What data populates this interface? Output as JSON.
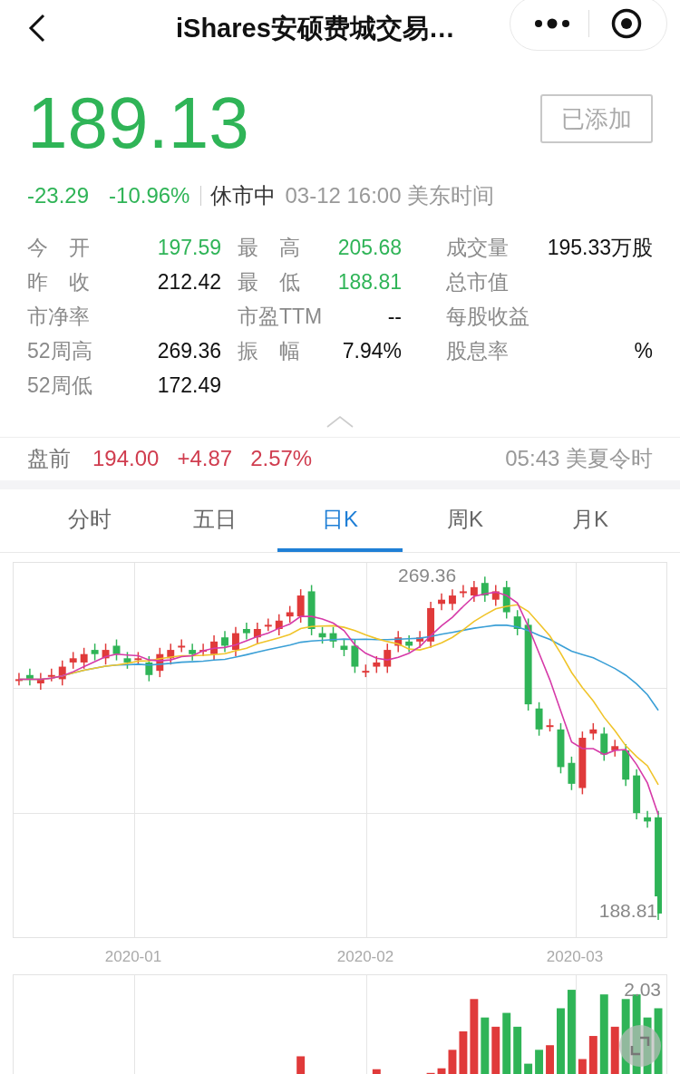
{
  "header": {
    "title": "iShares安硕费城交易…"
  },
  "quote": {
    "price": "189.13",
    "change": "-23.29",
    "change_pct": "-10.96%",
    "status": "休市中",
    "time": "03-12 16:00 美东时间",
    "add_button": {
      "label": "已添加",
      "disabled": true
    }
  },
  "stats": [
    {
      "label": "今　开",
      "value": "197.59",
      "color": "#2fb457"
    },
    {
      "label": "最　高",
      "value": "205.68",
      "color": "#2fb457"
    },
    {
      "label": "成交量",
      "value": "195.33万股",
      "color": "#111111"
    },
    {
      "label": "昨　收",
      "value": "212.42",
      "color": "#111111"
    },
    {
      "label": "最　低",
      "value": "188.81",
      "color": "#2fb457"
    },
    {
      "label": "总市值"
    },
    {
      "label": "市净率"
    },
    {
      "label": "市盈TTM",
      "value": "--",
      "color": "#111111"
    },
    {
      "label": "每股收益"
    },
    {
      "label": "52周高",
      "value": "269.36",
      "color": "#111111"
    },
    {
      "label": "振　幅",
      "value": "7.94%",
      "color": "#111111"
    },
    {
      "label": "股息率",
      "value": "%",
      "color": "#111111"
    },
    {
      "label": "52周低",
      "value": "172.49",
      "color": "#111111"
    }
  ],
  "premarket": {
    "label": "盘前",
    "price": "194.00",
    "change": "+4.87",
    "change_pct": "2.57%",
    "time": "05:43 美夏令时"
  },
  "tabs": [
    {
      "label": "分时",
      "selected": false
    },
    {
      "label": "五日",
      "selected": false
    },
    {
      "label": "日K",
      "selected": true
    },
    {
      "label": "周K",
      "selected": false
    },
    {
      "label": "月K",
      "selected": false
    }
  ],
  "kline": {
    "high_label": "269.36",
    "low_label": "188.81",
    "dates": [
      "2020-01",
      "2020-02",
      "2020-03"
    ]
  },
  "volume": {
    "max_label": "2.03"
  }
}
